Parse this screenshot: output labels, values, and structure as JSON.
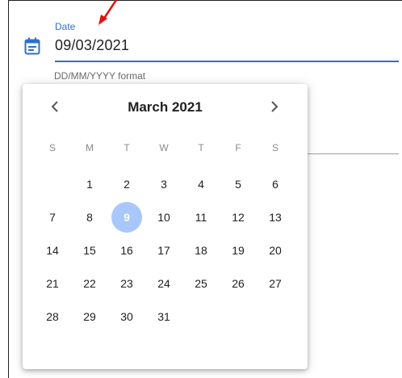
{
  "field": {
    "label": "Date",
    "value": "09/03/2021",
    "hint": "DD/MM/YYYY format"
  },
  "calendar": {
    "month_title": "March 2021",
    "weekdays": [
      "S",
      "M",
      "T",
      "W",
      "T",
      "F",
      "S"
    ],
    "weeks": [
      [
        "",
        "1",
        "2",
        "3",
        "4",
        "5",
        "6"
      ],
      [
        "7",
        "8",
        "9",
        "10",
        "11",
        "12",
        "13"
      ],
      [
        "14",
        "15",
        "16",
        "17",
        "18",
        "19",
        "20"
      ],
      [
        "21",
        "22",
        "23",
        "24",
        "25",
        "26",
        "27"
      ],
      [
        "28",
        "29",
        "30",
        "31",
        "",
        "",
        ""
      ]
    ],
    "selected_day": "9"
  },
  "colors": {
    "accent": "#2f6fcf",
    "selected_day": "#a9c7fb",
    "annotation_arrow": "#e01010"
  }
}
